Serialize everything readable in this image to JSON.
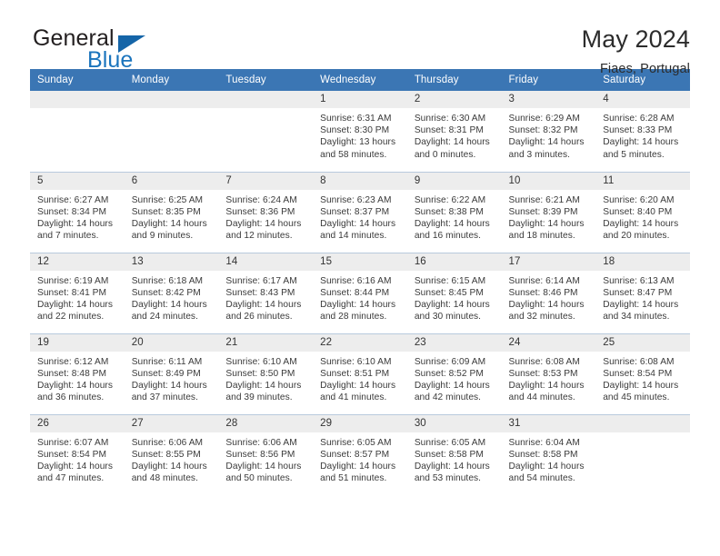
{
  "brand": {
    "name_part1": "General",
    "name_part2": "Blue",
    "logo_icon": "triangle-logo-icon"
  },
  "header": {
    "title": "May 2024",
    "subtitle": "Fiaes, Portugal"
  },
  "colors": {
    "header_blue": "#3b76b4",
    "brand_blue": "#1a74bd",
    "daynum_bg": "#ededed",
    "grid_line": "#b8cadd"
  },
  "weekday_headers": [
    "Sunday",
    "Monday",
    "Tuesday",
    "Wednesday",
    "Thursday",
    "Friday",
    "Saturday"
  ],
  "weeks": [
    [
      {
        "day": "",
        "empty": true,
        "sunrise": "",
        "sunset": "",
        "daylight": ""
      },
      {
        "day": "",
        "empty": true,
        "sunrise": "",
        "sunset": "",
        "daylight": ""
      },
      {
        "day": "",
        "empty": true,
        "sunrise": "",
        "sunset": "",
        "daylight": ""
      },
      {
        "day": "1",
        "empty": false,
        "sunrise": "Sunrise: 6:31 AM",
        "sunset": "Sunset: 8:30 PM",
        "daylight": "Daylight: 13 hours and 58 minutes."
      },
      {
        "day": "2",
        "empty": false,
        "sunrise": "Sunrise: 6:30 AM",
        "sunset": "Sunset: 8:31 PM",
        "daylight": "Daylight: 14 hours and 0 minutes."
      },
      {
        "day": "3",
        "empty": false,
        "sunrise": "Sunrise: 6:29 AM",
        "sunset": "Sunset: 8:32 PM",
        "daylight": "Daylight: 14 hours and 3 minutes."
      },
      {
        "day": "4",
        "empty": false,
        "sunrise": "Sunrise: 6:28 AM",
        "sunset": "Sunset: 8:33 PM",
        "daylight": "Daylight: 14 hours and 5 minutes."
      }
    ],
    [
      {
        "day": "5",
        "empty": false,
        "sunrise": "Sunrise: 6:27 AM",
        "sunset": "Sunset: 8:34 PM",
        "daylight": "Daylight: 14 hours and 7 minutes."
      },
      {
        "day": "6",
        "empty": false,
        "sunrise": "Sunrise: 6:25 AM",
        "sunset": "Sunset: 8:35 PM",
        "daylight": "Daylight: 14 hours and 9 minutes."
      },
      {
        "day": "7",
        "empty": false,
        "sunrise": "Sunrise: 6:24 AM",
        "sunset": "Sunset: 8:36 PM",
        "daylight": "Daylight: 14 hours and 12 minutes."
      },
      {
        "day": "8",
        "empty": false,
        "sunrise": "Sunrise: 6:23 AM",
        "sunset": "Sunset: 8:37 PM",
        "daylight": "Daylight: 14 hours and 14 minutes."
      },
      {
        "day": "9",
        "empty": false,
        "sunrise": "Sunrise: 6:22 AM",
        "sunset": "Sunset: 8:38 PM",
        "daylight": "Daylight: 14 hours and 16 minutes."
      },
      {
        "day": "10",
        "empty": false,
        "sunrise": "Sunrise: 6:21 AM",
        "sunset": "Sunset: 8:39 PM",
        "daylight": "Daylight: 14 hours and 18 minutes."
      },
      {
        "day": "11",
        "empty": false,
        "sunrise": "Sunrise: 6:20 AM",
        "sunset": "Sunset: 8:40 PM",
        "daylight": "Daylight: 14 hours and 20 minutes."
      }
    ],
    [
      {
        "day": "12",
        "empty": false,
        "sunrise": "Sunrise: 6:19 AM",
        "sunset": "Sunset: 8:41 PM",
        "daylight": "Daylight: 14 hours and 22 minutes."
      },
      {
        "day": "13",
        "empty": false,
        "sunrise": "Sunrise: 6:18 AM",
        "sunset": "Sunset: 8:42 PM",
        "daylight": "Daylight: 14 hours and 24 minutes."
      },
      {
        "day": "14",
        "empty": false,
        "sunrise": "Sunrise: 6:17 AM",
        "sunset": "Sunset: 8:43 PM",
        "daylight": "Daylight: 14 hours and 26 minutes."
      },
      {
        "day": "15",
        "empty": false,
        "sunrise": "Sunrise: 6:16 AM",
        "sunset": "Sunset: 8:44 PM",
        "daylight": "Daylight: 14 hours and 28 minutes."
      },
      {
        "day": "16",
        "empty": false,
        "sunrise": "Sunrise: 6:15 AM",
        "sunset": "Sunset: 8:45 PM",
        "daylight": "Daylight: 14 hours and 30 minutes."
      },
      {
        "day": "17",
        "empty": false,
        "sunrise": "Sunrise: 6:14 AM",
        "sunset": "Sunset: 8:46 PM",
        "daylight": "Daylight: 14 hours and 32 minutes."
      },
      {
        "day": "18",
        "empty": false,
        "sunrise": "Sunrise: 6:13 AM",
        "sunset": "Sunset: 8:47 PM",
        "daylight": "Daylight: 14 hours and 34 minutes."
      }
    ],
    [
      {
        "day": "19",
        "empty": false,
        "sunrise": "Sunrise: 6:12 AM",
        "sunset": "Sunset: 8:48 PM",
        "daylight": "Daylight: 14 hours and 36 minutes."
      },
      {
        "day": "20",
        "empty": false,
        "sunrise": "Sunrise: 6:11 AM",
        "sunset": "Sunset: 8:49 PM",
        "daylight": "Daylight: 14 hours and 37 minutes."
      },
      {
        "day": "21",
        "empty": false,
        "sunrise": "Sunrise: 6:10 AM",
        "sunset": "Sunset: 8:50 PM",
        "daylight": "Daylight: 14 hours and 39 minutes."
      },
      {
        "day": "22",
        "empty": false,
        "sunrise": "Sunrise: 6:10 AM",
        "sunset": "Sunset: 8:51 PM",
        "daylight": "Daylight: 14 hours and 41 minutes."
      },
      {
        "day": "23",
        "empty": false,
        "sunrise": "Sunrise: 6:09 AM",
        "sunset": "Sunset: 8:52 PM",
        "daylight": "Daylight: 14 hours and 42 minutes."
      },
      {
        "day": "24",
        "empty": false,
        "sunrise": "Sunrise: 6:08 AM",
        "sunset": "Sunset: 8:53 PM",
        "daylight": "Daylight: 14 hours and 44 minutes."
      },
      {
        "day": "25",
        "empty": false,
        "sunrise": "Sunrise: 6:08 AM",
        "sunset": "Sunset: 8:54 PM",
        "daylight": "Daylight: 14 hours and 45 minutes."
      }
    ],
    [
      {
        "day": "26",
        "empty": false,
        "sunrise": "Sunrise: 6:07 AM",
        "sunset": "Sunset: 8:54 PM",
        "daylight": "Daylight: 14 hours and 47 minutes."
      },
      {
        "day": "27",
        "empty": false,
        "sunrise": "Sunrise: 6:06 AM",
        "sunset": "Sunset: 8:55 PM",
        "daylight": "Daylight: 14 hours and 48 minutes."
      },
      {
        "day": "28",
        "empty": false,
        "sunrise": "Sunrise: 6:06 AM",
        "sunset": "Sunset: 8:56 PM",
        "daylight": "Daylight: 14 hours and 50 minutes."
      },
      {
        "day": "29",
        "empty": false,
        "sunrise": "Sunrise: 6:05 AM",
        "sunset": "Sunset: 8:57 PM",
        "daylight": "Daylight: 14 hours and 51 minutes."
      },
      {
        "day": "30",
        "empty": false,
        "sunrise": "Sunrise: 6:05 AM",
        "sunset": "Sunset: 8:58 PM",
        "daylight": "Daylight: 14 hours and 53 minutes."
      },
      {
        "day": "31",
        "empty": false,
        "sunrise": "Sunrise: 6:04 AM",
        "sunset": "Sunset: 8:58 PM",
        "daylight": "Daylight: 14 hours and 54 minutes."
      },
      {
        "day": "",
        "empty": true,
        "sunrise": "",
        "sunset": "",
        "daylight": ""
      }
    ]
  ]
}
